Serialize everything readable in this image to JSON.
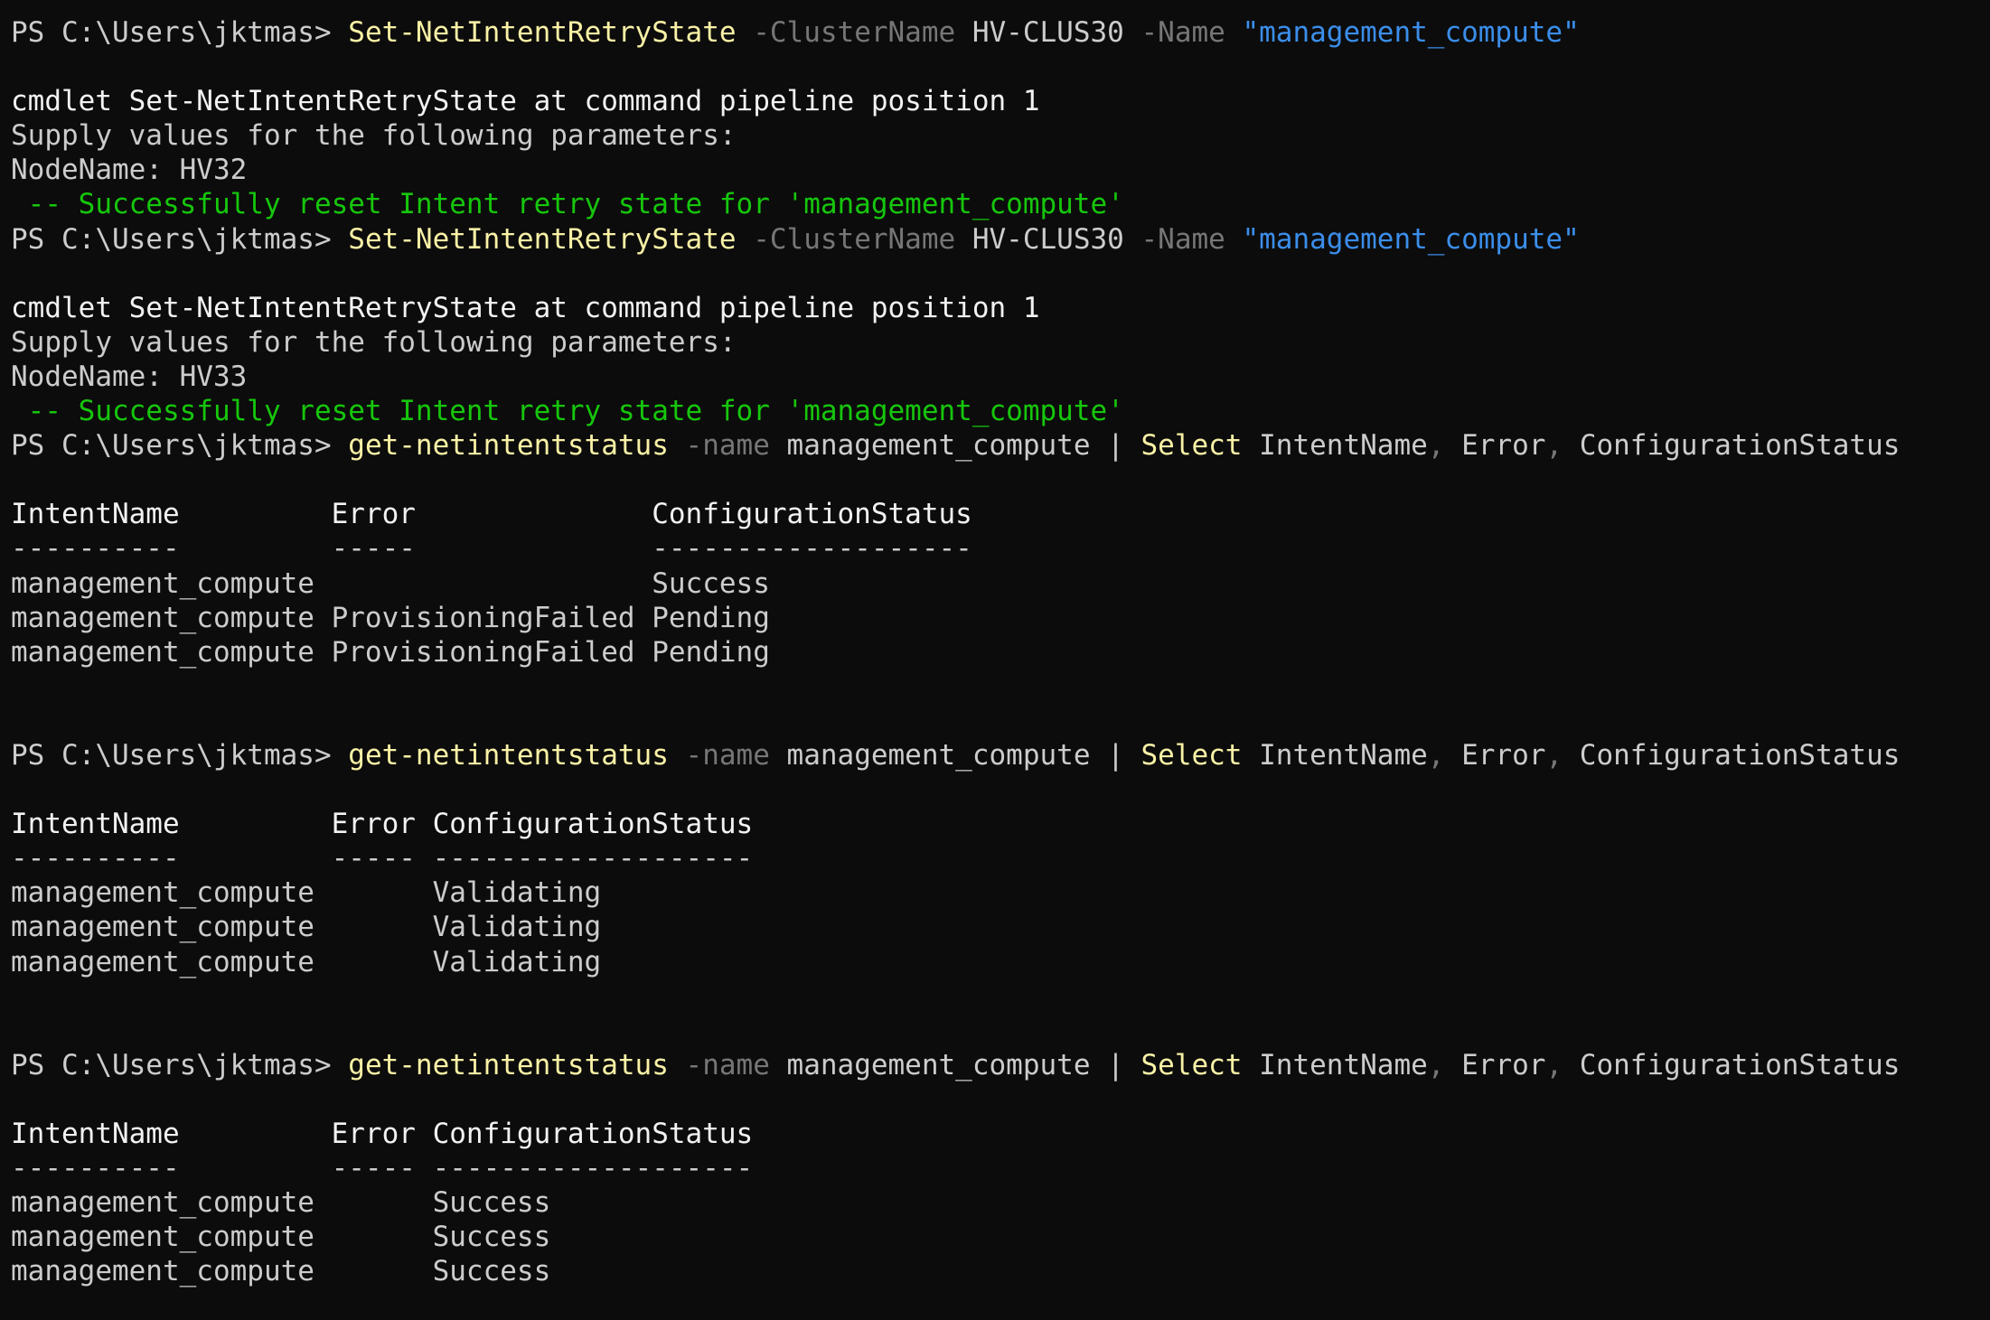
{
  "terminal": {
    "lines": [
      {
        "segments": [
          {
            "text": "PS C:\\Users\\jktmas> ",
            "role": "prompt"
          },
          {
            "text": "Set-NetIntentRetryState",
            "role": "command"
          },
          {
            "text": " -ClusterName",
            "role": "parameter"
          },
          {
            "text": " HV-CLUS30",
            "role": "argument"
          },
          {
            "text": " -Name",
            "role": "parameter"
          },
          {
            "text": " \"management_compute\"",
            "role": "string"
          }
        ]
      },
      {
        "segments": []
      },
      {
        "segments": [
          {
            "text": "cmdlet Set-NetIntentRetryState at command pipeline position 1",
            "role": "output-bright"
          }
        ]
      },
      {
        "segments": [
          {
            "text": "Supply values for the following parameters:",
            "role": "output"
          }
        ]
      },
      {
        "segments": [
          {
            "text": "NodeName: HV32",
            "role": "output"
          }
        ]
      },
      {
        "segments": [
          {
            "text": " -- Successfully reset Intent retry state for 'management_compute'",
            "role": "success"
          }
        ]
      },
      {
        "segments": [
          {
            "text": "PS C:\\Users\\jktmas> ",
            "role": "prompt"
          },
          {
            "text": "Set-NetIntentRetryState",
            "role": "command"
          },
          {
            "text": " -ClusterName",
            "role": "parameter"
          },
          {
            "text": " HV-CLUS30",
            "role": "argument"
          },
          {
            "text": " -Name",
            "role": "parameter"
          },
          {
            "text": " \"management_compute\"",
            "role": "string"
          }
        ]
      },
      {
        "segments": []
      },
      {
        "segments": [
          {
            "text": "cmdlet Set-NetIntentRetryState at command pipeline position 1",
            "role": "output-bright"
          }
        ]
      },
      {
        "segments": [
          {
            "text": "Supply values for the following parameters:",
            "role": "output"
          }
        ]
      },
      {
        "segments": [
          {
            "text": "NodeName: HV33",
            "role": "output"
          }
        ]
      },
      {
        "segments": [
          {
            "text": " -- Successfully reset Intent retry state for 'management_compute'",
            "role": "success"
          }
        ]
      },
      {
        "segments": [
          {
            "text": "PS C:\\Users\\jktmas> ",
            "role": "prompt"
          },
          {
            "text": "get-netintentstatus",
            "role": "command"
          },
          {
            "text": " -name",
            "role": "parameter"
          },
          {
            "text": " management_compute ",
            "role": "argument"
          },
          {
            "text": "|",
            "role": "operator"
          },
          {
            "text": " Select",
            "role": "command"
          },
          {
            "text": " IntentName",
            "role": "argument"
          },
          {
            "text": ",",
            "role": "parameter"
          },
          {
            "text": " Error",
            "role": "argument"
          },
          {
            "text": ",",
            "role": "parameter"
          },
          {
            "text": " ConfigurationStatus",
            "role": "argument"
          }
        ]
      },
      {
        "segments": []
      },
      {
        "segments": [
          {
            "text": "IntentName         Error              ConfigurationStatus",
            "role": "output-bright"
          }
        ]
      },
      {
        "segments": [
          {
            "text": "----------         -----              -------------------",
            "role": "output"
          }
        ]
      },
      {
        "segments": [
          {
            "text": "management_compute                    Success",
            "role": "output"
          }
        ]
      },
      {
        "segments": [
          {
            "text": "management_compute ProvisioningFailed Pending",
            "role": "output"
          }
        ]
      },
      {
        "segments": [
          {
            "text": "management_compute ProvisioningFailed Pending",
            "role": "output"
          }
        ]
      },
      {
        "segments": []
      },
      {
        "segments": []
      },
      {
        "segments": [
          {
            "text": "PS C:\\Users\\jktmas> ",
            "role": "prompt"
          },
          {
            "text": "get-netintentstatus",
            "role": "command"
          },
          {
            "text": " -name",
            "role": "parameter"
          },
          {
            "text": " management_compute ",
            "role": "argument"
          },
          {
            "text": "|",
            "role": "operator"
          },
          {
            "text": " Select",
            "role": "command"
          },
          {
            "text": " IntentName",
            "role": "argument"
          },
          {
            "text": ",",
            "role": "parameter"
          },
          {
            "text": " Error",
            "role": "argument"
          },
          {
            "text": ",",
            "role": "parameter"
          },
          {
            "text": " ConfigurationStatus",
            "role": "argument"
          }
        ]
      },
      {
        "segments": []
      },
      {
        "segments": [
          {
            "text": "IntentName         Error ConfigurationStatus",
            "role": "output-bright"
          }
        ]
      },
      {
        "segments": [
          {
            "text": "----------         ----- -------------------",
            "role": "output"
          }
        ]
      },
      {
        "segments": [
          {
            "text": "management_compute       Validating",
            "role": "output"
          }
        ]
      },
      {
        "segments": [
          {
            "text": "management_compute       Validating",
            "role": "output"
          }
        ]
      },
      {
        "segments": [
          {
            "text": "management_compute       Validating",
            "role": "output"
          }
        ]
      },
      {
        "segments": []
      },
      {
        "segments": []
      },
      {
        "segments": [
          {
            "text": "PS C:\\Users\\jktmas> ",
            "role": "prompt"
          },
          {
            "text": "get-netintentstatus",
            "role": "command"
          },
          {
            "text": " -name",
            "role": "parameter"
          },
          {
            "text": " management_compute ",
            "role": "argument"
          },
          {
            "text": "|",
            "role": "operator"
          },
          {
            "text": " Select",
            "role": "command"
          },
          {
            "text": " IntentName",
            "role": "argument"
          },
          {
            "text": ",",
            "role": "parameter"
          },
          {
            "text": " Error",
            "role": "argument"
          },
          {
            "text": ",",
            "role": "parameter"
          },
          {
            "text": " ConfigurationStatus",
            "role": "argument"
          }
        ]
      },
      {
        "segments": []
      },
      {
        "segments": [
          {
            "text": "IntentName         Error ConfigurationStatus",
            "role": "output-bright"
          }
        ]
      },
      {
        "segments": [
          {
            "text": "----------         ----- -------------------",
            "role": "output"
          }
        ]
      },
      {
        "segments": [
          {
            "text": "management_compute       Success",
            "role": "output"
          }
        ]
      },
      {
        "segments": [
          {
            "text": "management_compute       Success",
            "role": "output"
          }
        ]
      },
      {
        "segments": [
          {
            "text": "management_compute       Success",
            "role": "output"
          }
        ]
      }
    ]
  },
  "colors": {
    "background": "#0c0c0c",
    "foreground": "#cccccc",
    "command": "#f9f1a5",
    "parameter": "#767676",
    "string": "#3b8eea",
    "success": "#16c60c"
  }
}
